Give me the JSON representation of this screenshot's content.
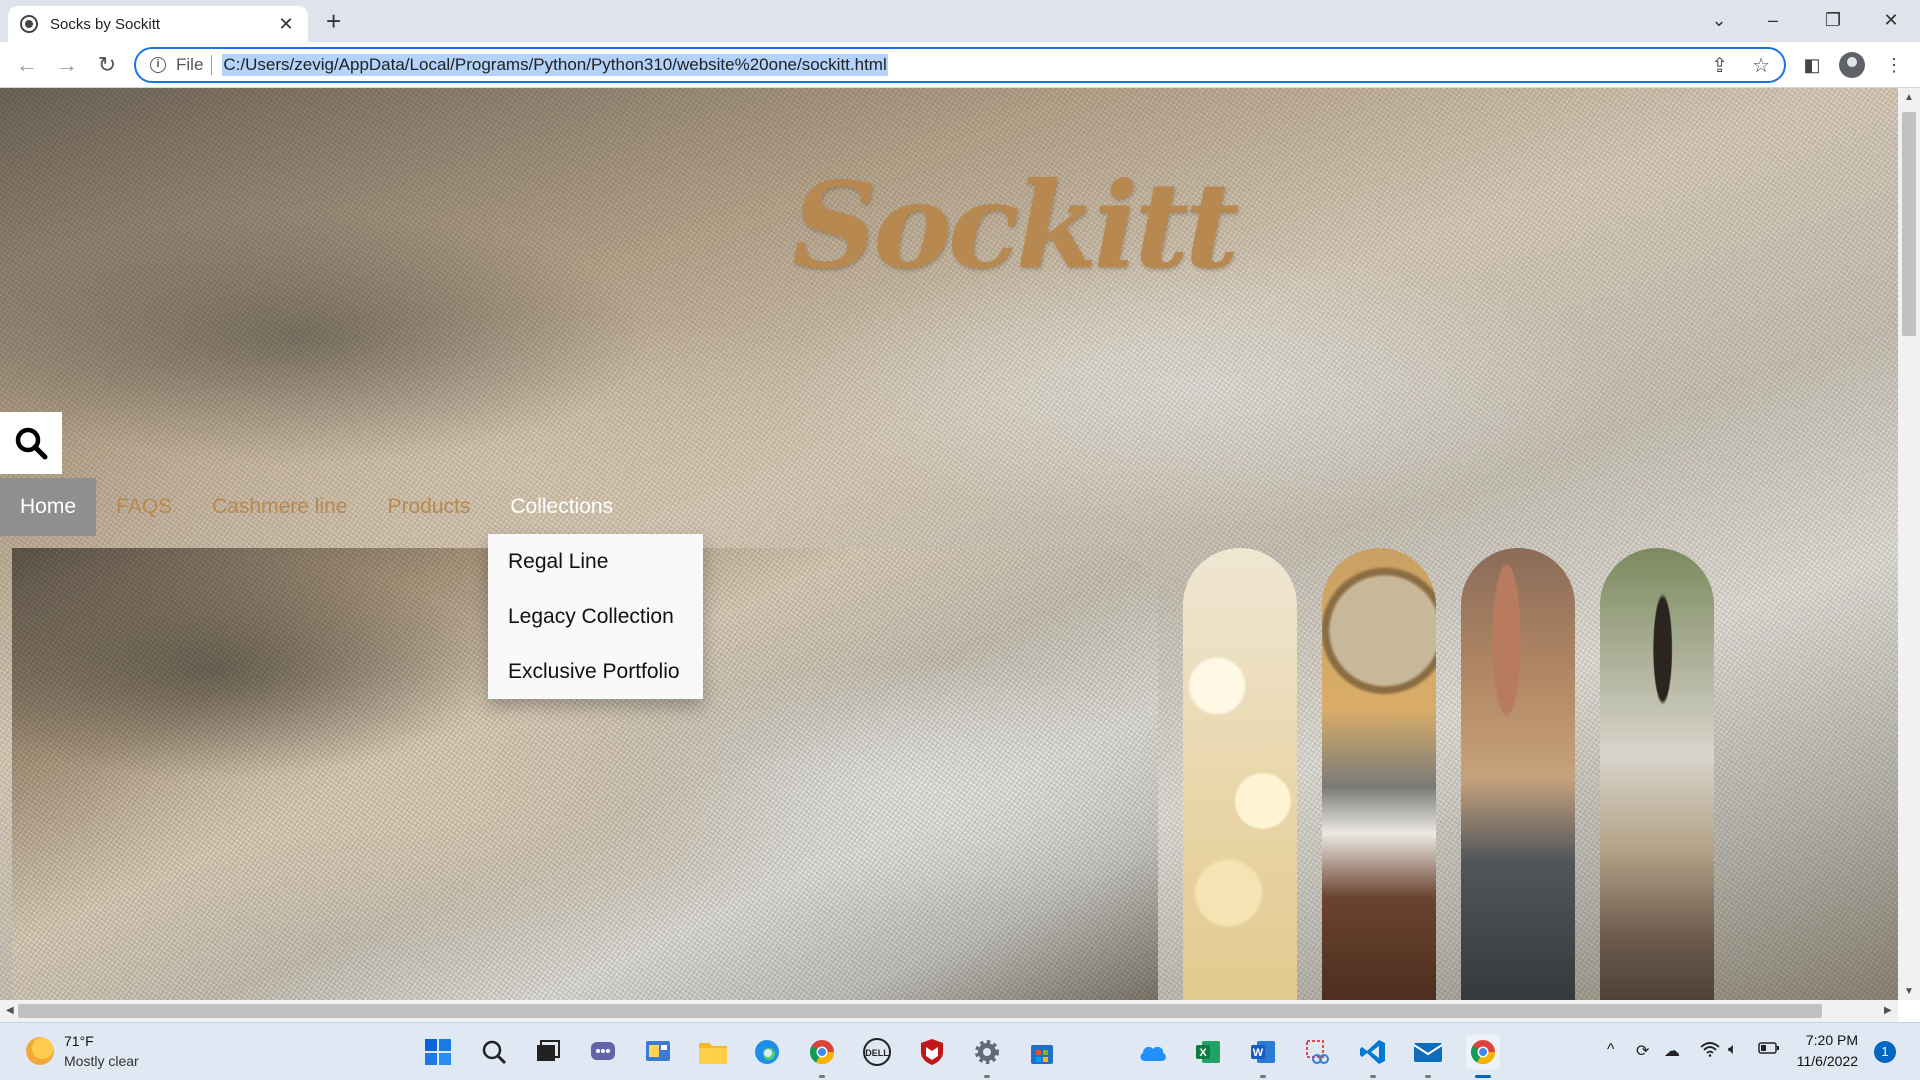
{
  "browser": {
    "tab_title": "Socks by Sockitt",
    "tab_close": "✕",
    "new_tab": "+",
    "scheme_label": "File",
    "url": "C:/Users/zevig/AppData/Local/Programs/Python/Python310/website%20one/sockitt.html"
  },
  "page": {
    "logo": "Sockitt",
    "nav": [
      {
        "label": "Home",
        "state": "active"
      },
      {
        "label": "FAQS"
      },
      {
        "label": "Cashmere line"
      },
      {
        "label": "Products"
      },
      {
        "label": "Collections",
        "state": "hover"
      }
    ],
    "dropdown": [
      "Regal Line",
      "Legacy Collection",
      "Exclusive Portfolio"
    ]
  },
  "taskbar": {
    "weather_temp": "71°F",
    "weather_condition": "Mostly clear",
    "time": "7:20 PM",
    "date": "11/6/2022",
    "notification_count": "1"
  },
  "colors": {
    "brand_gold": "#b7884f",
    "nav_active_bg": "#8f8f8f",
    "omnibox_focus": "#1a73e8",
    "taskbar_bg": "#dfe8f3"
  }
}
